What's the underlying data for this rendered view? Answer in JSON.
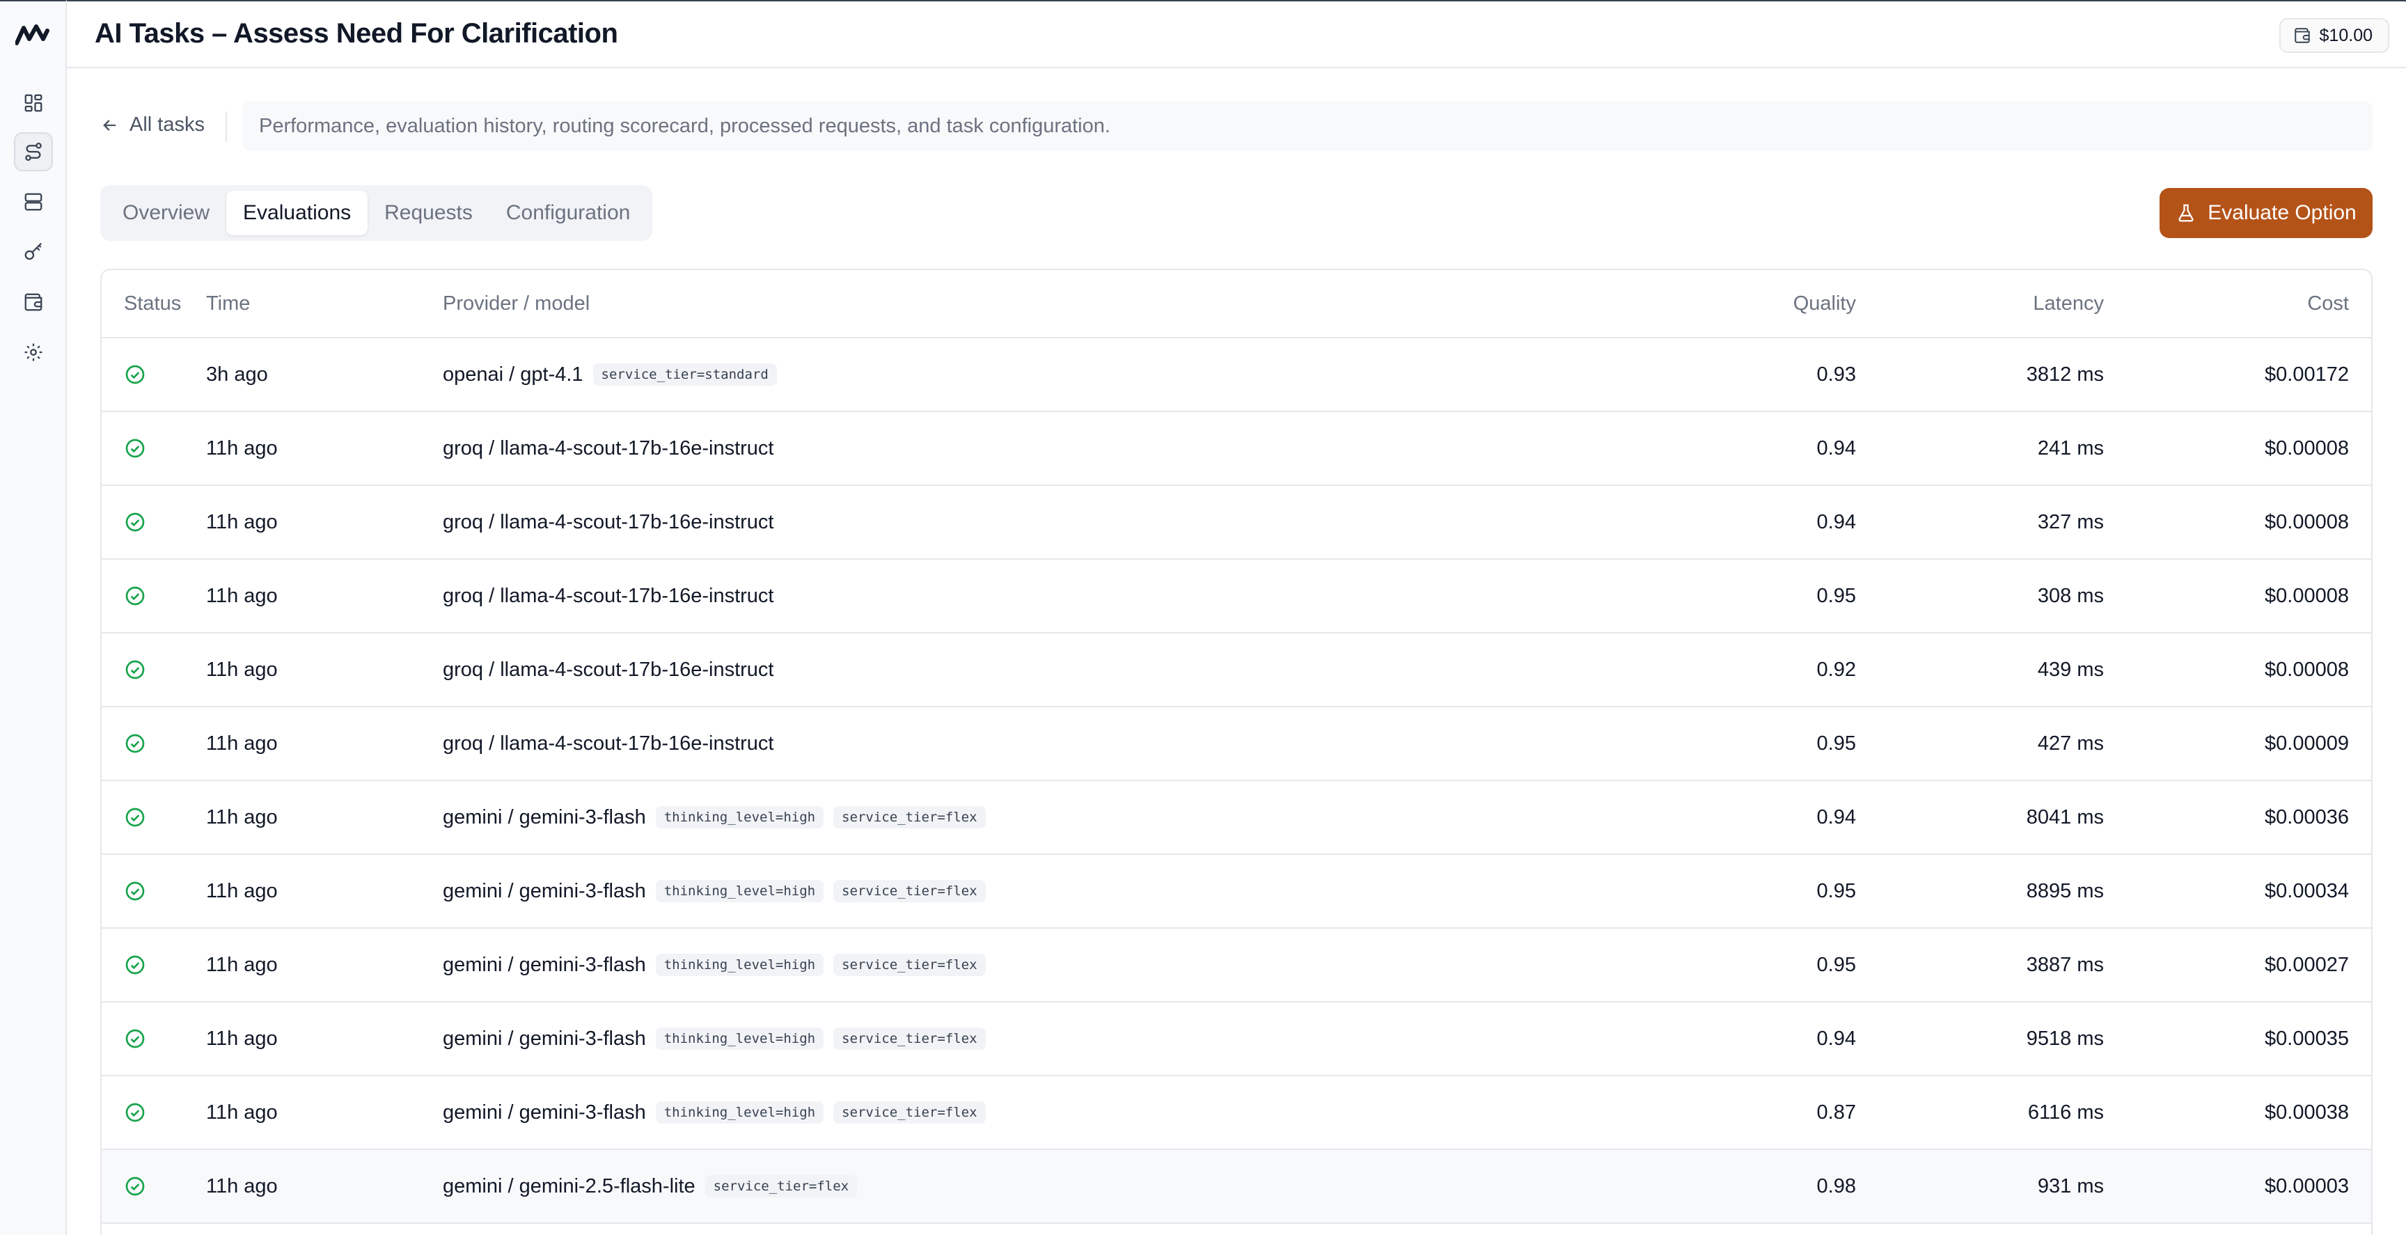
{
  "app": {
    "title": "AI Tasks – Assess Need For Clarification",
    "balance": "$10.00"
  },
  "sidebar": {
    "items": [
      {
        "name": "dashboard",
        "icon": "dashboard-icon"
      },
      {
        "name": "routing",
        "icon": "routing-icon",
        "active": true
      },
      {
        "name": "storage",
        "icon": "server-icon"
      },
      {
        "name": "keys",
        "icon": "key-icon"
      },
      {
        "name": "billing",
        "icon": "wallet-icon"
      },
      {
        "name": "settings",
        "icon": "gear-icon"
      }
    ]
  },
  "breadcrumb": {
    "back_label": "All tasks",
    "description": "Performance, evaluation history, routing scorecard, processed requests, and task configuration."
  },
  "tabs": [
    {
      "label": "Overview",
      "active": false
    },
    {
      "label": "Evaluations",
      "active": true
    },
    {
      "label": "Requests",
      "active": false
    },
    {
      "label": "Configuration",
      "active": false
    }
  ],
  "evaluate_button": {
    "label": "Evaluate Option"
  },
  "colors": {
    "accent": "#b45318",
    "success": "#16a34a"
  },
  "table": {
    "headers": {
      "status": "Status",
      "time": "Time",
      "model": "Provider / model",
      "quality": "Quality",
      "latency": "Latency",
      "cost": "Cost"
    },
    "rows": [
      {
        "time": "3h ago",
        "model": "openai / gpt-4.1",
        "tags": [
          "service_tier=standard"
        ],
        "quality": "0.93",
        "latency": "3812 ms",
        "cost": "$0.00172"
      },
      {
        "time": "11h ago",
        "model": "groq / llama-4-scout-17b-16e-instruct",
        "tags": [],
        "quality": "0.94",
        "latency": "241 ms",
        "cost": "$0.00008"
      },
      {
        "time": "11h ago",
        "model": "groq / llama-4-scout-17b-16e-instruct",
        "tags": [],
        "quality": "0.94",
        "latency": "327 ms",
        "cost": "$0.00008"
      },
      {
        "time": "11h ago",
        "model": "groq / llama-4-scout-17b-16e-instruct",
        "tags": [],
        "quality": "0.95",
        "latency": "308 ms",
        "cost": "$0.00008"
      },
      {
        "time": "11h ago",
        "model": "groq / llama-4-scout-17b-16e-instruct",
        "tags": [],
        "quality": "0.92",
        "latency": "439 ms",
        "cost": "$0.00008"
      },
      {
        "time": "11h ago",
        "model": "groq / llama-4-scout-17b-16e-instruct",
        "tags": [],
        "quality": "0.95",
        "latency": "427 ms",
        "cost": "$0.00009"
      },
      {
        "time": "11h ago",
        "model": "gemini / gemini-3-flash",
        "tags": [
          "thinking_level=high",
          "service_tier=flex"
        ],
        "quality": "0.94",
        "latency": "8041 ms",
        "cost": "$0.00036"
      },
      {
        "time": "11h ago",
        "model": "gemini / gemini-3-flash",
        "tags": [
          "thinking_level=high",
          "service_tier=flex"
        ],
        "quality": "0.95",
        "latency": "8895 ms",
        "cost": "$0.00034"
      },
      {
        "time": "11h ago",
        "model": "gemini / gemini-3-flash",
        "tags": [
          "thinking_level=high",
          "service_tier=flex"
        ],
        "quality": "0.95",
        "latency": "3887 ms",
        "cost": "$0.00027"
      },
      {
        "time": "11h ago",
        "model": "gemini / gemini-3-flash",
        "tags": [
          "thinking_level=high",
          "service_tier=flex"
        ],
        "quality": "0.94",
        "latency": "9518 ms",
        "cost": "$0.00035"
      },
      {
        "time": "11h ago",
        "model": "gemini / gemini-3-flash",
        "tags": [
          "thinking_level=high",
          "service_tier=flex"
        ],
        "quality": "0.87",
        "latency": "6116 ms",
        "cost": "$0.00038"
      },
      {
        "time": "11h ago",
        "model": "gemini / gemini-2.5-flash-lite",
        "tags": [
          "service_tier=flex"
        ],
        "quality": "0.98",
        "latency": "931 ms",
        "cost": "$0.00003",
        "highlighted": true
      }
    ]
  }
}
